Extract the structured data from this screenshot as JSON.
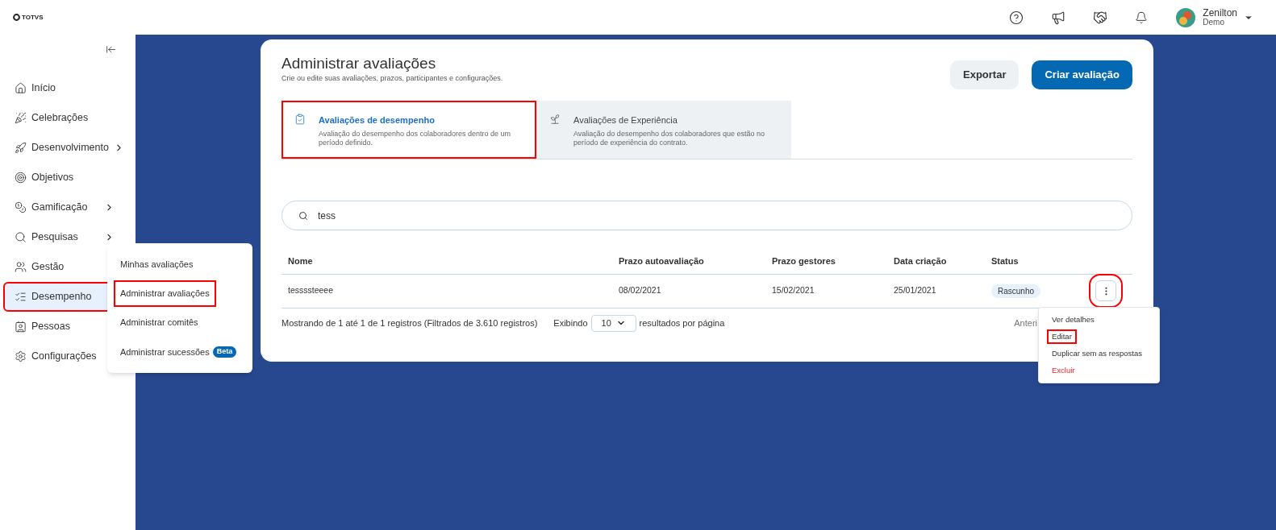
{
  "header": {
    "logo_text": "TOTVS",
    "user_name": "Zenilton",
    "user_role": "Demo"
  },
  "sidebar": {
    "items": [
      {
        "kind": "home",
        "label": "Início",
        "has_submenu": false,
        "selected": false,
        "highlighted": false
      },
      {
        "kind": "party",
        "label": "Celebrações",
        "has_submenu": false,
        "selected": false,
        "highlighted": false
      },
      {
        "kind": "rocket",
        "label": "Desenvolvimento",
        "has_submenu": true,
        "selected": false,
        "highlighted": false
      },
      {
        "kind": "target",
        "label": "Objetivos",
        "has_submenu": false,
        "selected": false,
        "highlighted": false
      },
      {
        "kind": "coins",
        "label": "Gamificação",
        "has_submenu": true,
        "selected": false,
        "highlighted": false
      },
      {
        "kind": "search",
        "label": "Pesquisas",
        "has_submenu": true,
        "selected": false,
        "highlighted": false
      },
      {
        "kind": "users",
        "label": "Gestão",
        "selected": false,
        "highlighted": false
      },
      {
        "kind": "list",
        "label": "Desempenho",
        "has_submenu": false,
        "selected": true,
        "highlighted": true
      },
      {
        "kind": "badge",
        "label": "Pessoas",
        "selected": false,
        "highlighted": false
      },
      {
        "kind": "gear",
        "label": "Configurações",
        "selected": false,
        "highlighted": false
      }
    ]
  },
  "submenu": {
    "items": [
      {
        "label": "Minhas avaliações",
        "highlighted": false
      },
      {
        "label": "Administrar avaliações",
        "highlighted": true
      },
      {
        "label": "Administrar comitês",
        "highlighted": false
      },
      {
        "label": "Administrar sucessões",
        "badge": "Beta",
        "highlighted": false
      }
    ]
  },
  "page": {
    "title": "Administrar avaliações",
    "subtitle": "Crie ou edite suas avaliações, prazos, participantes e configurações.",
    "buttons": [
      {
        "label": "Exportar",
        "kind": "secondary"
      },
      {
        "label": "Criar avaliação",
        "kind": "primary"
      }
    ]
  },
  "tabs": [
    {
      "kind": "clipboard",
      "title": "Avaliações de desempenho",
      "description": "Avaliação do desempenho dos colaboradores dentro de um período definido.",
      "selected": true,
      "highlighted": true
    },
    {
      "kind": "sprout",
      "title": "Avaliações de Experiência",
      "description": "Avaliação do desempenho dos colaboradores que estão no período de experiência do contrato.",
      "selected": false,
      "highlighted": false
    }
  ],
  "search": {
    "value": "tess"
  },
  "table": {
    "columns": [
      "Nome",
      "Prazo autoavaliação",
      "Prazo gestores",
      "Data criação",
      "Status"
    ],
    "rows": [
      {
        "cells": [
          "tessssteeee",
          "08/02/2021",
          "15/02/2021",
          "25/01/2021"
        ],
        "status": "Rascunho",
        "menu_highlighted": true
      }
    ]
  },
  "footer": {
    "summary": "Mostrando de 1 até 1 de 1 registros (Filtrados de 3.610 registros)",
    "showing_label": "Exibindo",
    "page_size": "10",
    "per_page_label": "resultados por página",
    "previous": "Anteri"
  },
  "row_menu": {
    "items": [
      {
        "label": "Ver detalhes",
        "kind": "normal",
        "highlighted": false
      },
      {
        "label": "Editar",
        "kind": "normal",
        "highlighted": true
      },
      {
        "label": "Duplicar sem as respostas",
        "kind": "normal",
        "highlighted": false
      },
      {
        "label": "Excluir",
        "kind": "danger",
        "highlighted": false
      }
    ]
  }
}
